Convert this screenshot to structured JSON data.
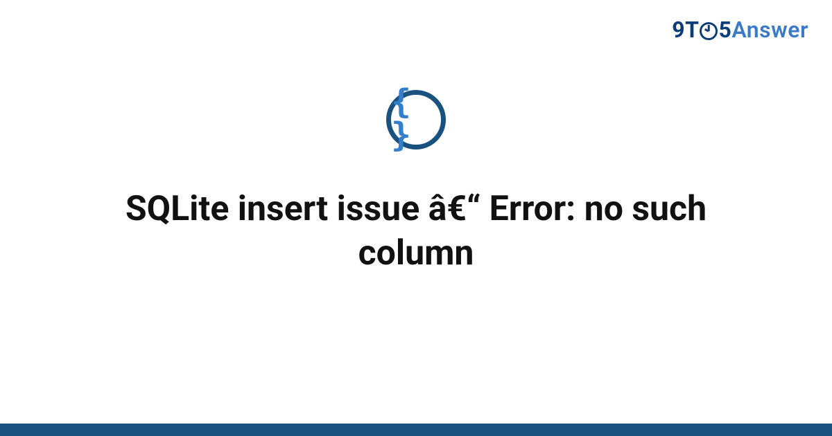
{
  "brand": {
    "nine": "9",
    "t": "T",
    "five": "5",
    "answer": "Answer"
  },
  "badge": {
    "glyph": "{ }"
  },
  "main": {
    "title": "SQLite insert issue â€“ Error: no such column"
  },
  "colors": {
    "brand_dark": "#0b3e78",
    "brand_light": "#3b7ac7",
    "ring": "#1a527f",
    "braces": "#337fc9",
    "text": "#111111",
    "footer": "#1a527f"
  }
}
